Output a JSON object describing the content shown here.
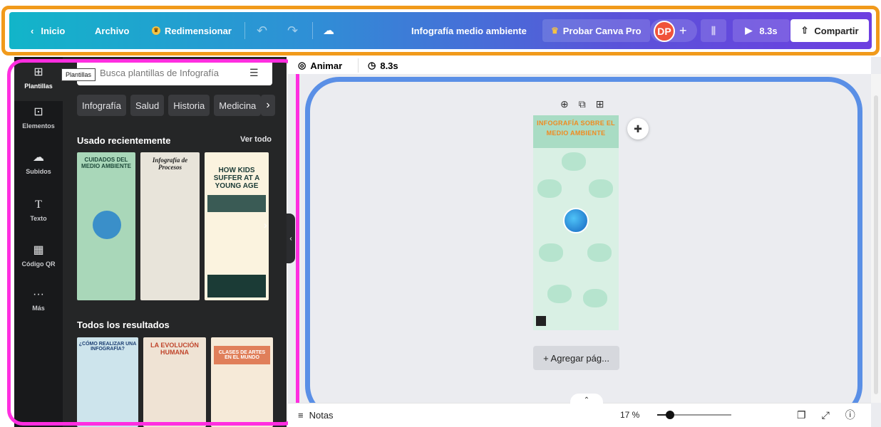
{
  "topbar": {
    "back_label": "Inicio",
    "file_label": "Archivo",
    "resize_label": "Redimensionar",
    "doc_title": "Infografía medio ambiente",
    "pro_label": "Probar Canva Pro",
    "avatar_initials": "DP",
    "play_duration": "8.3s",
    "share_label": "Compartir",
    "gradient_start": "#12b5c9",
    "gradient_end": "#6d3fe0"
  },
  "sidebar": {
    "items": [
      {
        "label": "Plantillas",
        "icon": "template-icon"
      },
      {
        "label": "Elementos",
        "icon": "shapes-icon"
      },
      {
        "label": "Subidos",
        "icon": "upload-cloud-icon"
      },
      {
        "label": "Texto",
        "icon": "text-icon"
      },
      {
        "label": "Código QR",
        "icon": "qr-code-icon"
      },
      {
        "label": "Más",
        "icon": "more-dots-icon"
      }
    ],
    "tooltip": "Plantillas"
  },
  "panel": {
    "search_placeholder": "Busca plantillas de Infografía",
    "chips": [
      "Infografía",
      "Salud",
      "Historia",
      "Medicina"
    ],
    "recent_title": "Usado recientemente",
    "see_all": "Ver todo",
    "recent_thumbs": [
      {
        "title": "CUIDADOS DEL MEDIO AMBIENTE"
      },
      {
        "title": "Infografía de Procesos"
      },
      {
        "title": "HOW KIDS SUFFER AT A YOUNG AGE"
      }
    ],
    "all_results_title": "Todos los resultados",
    "result_thumbs": [
      {
        "title": "¿CÓMO REALIZAR UNA INFOGRAFÍA?"
      },
      {
        "title": "LA EVOLUCIÓN HUMANA"
      },
      {
        "title": "CLASES DE ARTES EN EL MUNDO"
      }
    ]
  },
  "canvas": {
    "animate_label": "Animar",
    "duration": "8.3s",
    "page_title": "INFOGRAFÍA SOBRE EL MEDIO AMBIENTE",
    "add_page_label": "+ Agregar pág...",
    "notes_label": "Notas",
    "zoom": "17 %",
    "zoom_fraction": 0.17
  }
}
